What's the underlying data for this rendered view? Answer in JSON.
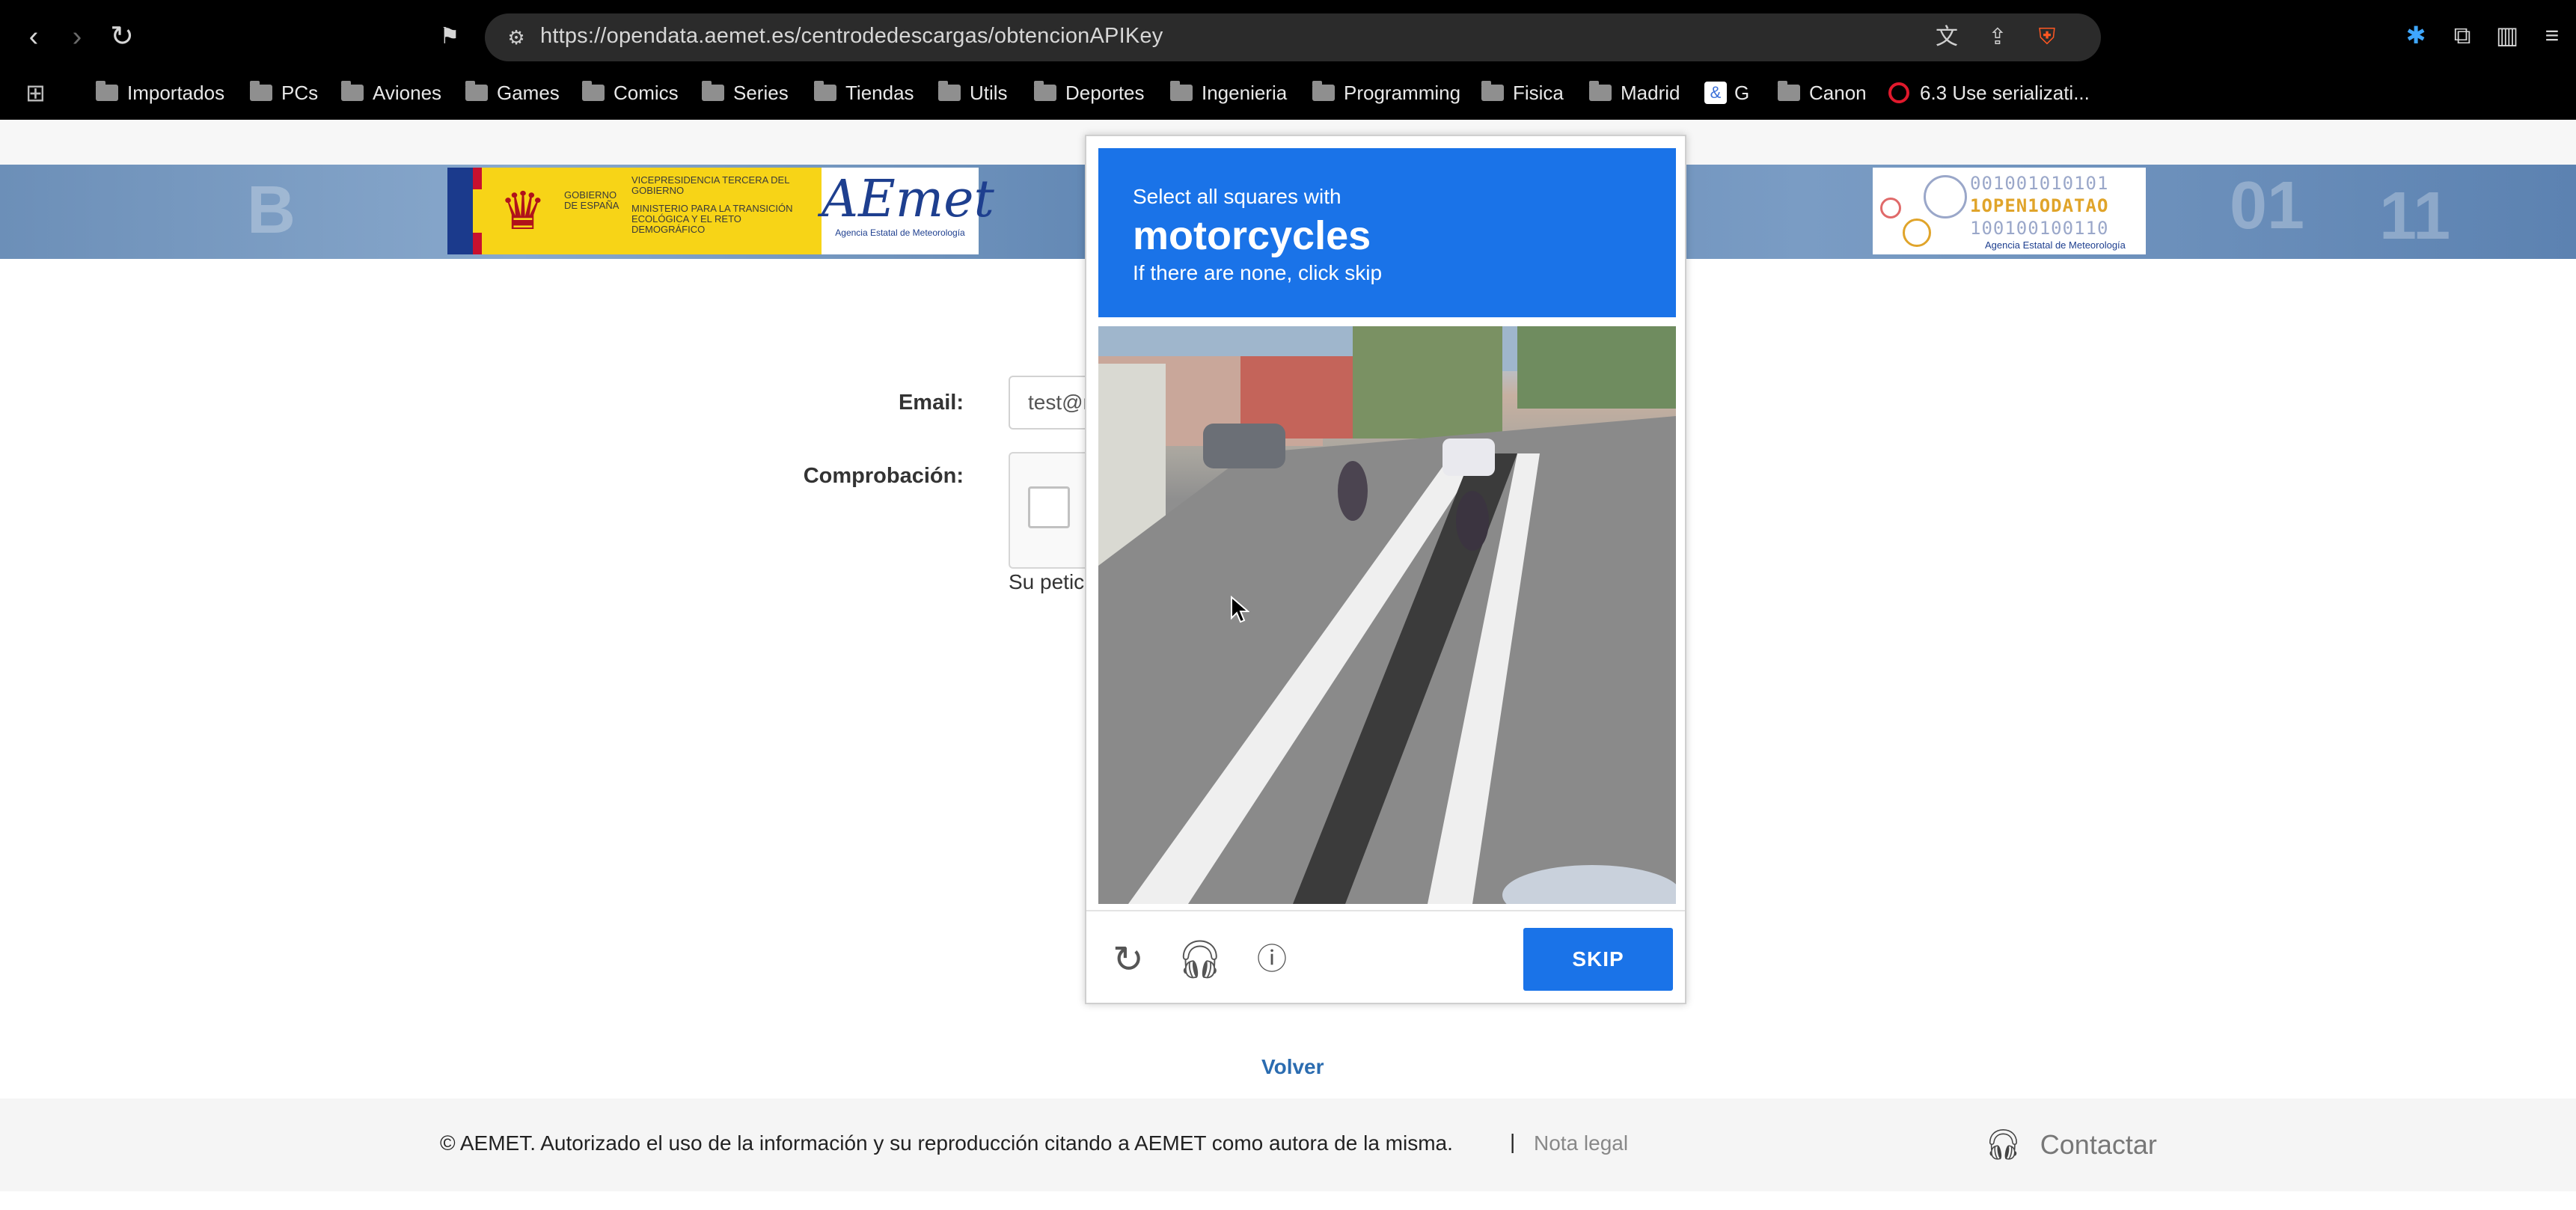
{
  "browser": {
    "url": "https://opendata.aemet.es/centrodedescargas/obtencionAPIKey",
    "nav": {
      "back_icon": "back-arrow-icon",
      "forward_icon": "forward-arrow-icon",
      "reload_icon": "reload-icon"
    },
    "bookmarks": [
      {
        "label": "Importados"
      },
      {
        "label": "PCs"
      },
      {
        "label": "Aviones"
      },
      {
        "label": "Games"
      },
      {
        "label": "Comics"
      },
      {
        "label": "Series"
      },
      {
        "label": "Tiendas"
      },
      {
        "label": "Utils"
      },
      {
        "label": "Deportes"
      },
      {
        "label": "Ingenieria"
      },
      {
        "label": "Programming"
      },
      {
        "label": "Fisica"
      },
      {
        "label": "Madrid"
      },
      {
        "label": "G"
      },
      {
        "label": "Canon"
      },
      {
        "label": "6.3 Use serializati..."
      }
    ],
    "accent_color": "#ff5722"
  },
  "header": {
    "gov_text_1": "GOBIERNO DE ESPAÑA",
    "gov_text_2": "VICEPRESIDENCIA TERCERA DEL GOBIERNO",
    "gov_text_3": "MINISTERIO PARA LA TRANSICIÓN ECOLÓGICA Y EL RETO DEMOGRÁFICO",
    "aemet_mark": "AEmet",
    "aemet_sub": "Agencia Estatal de Meteorología",
    "opendata_bits_1": "001001010101",
    "opendata_bits_2": "1OPEN1ODATAO",
    "opendata_bits_3": "100100100110",
    "opendata_sub": "Agencia Estatal de Meteorología"
  },
  "form": {
    "email_label": "Email:",
    "email_value": "test@r",
    "check_label": "Comprobación:",
    "request_text": "Su petic"
  },
  "captcha": {
    "pre": "Select all squares with",
    "object": "motorcycles",
    "post": "If there are none, click skip",
    "skip_label": "SKIP",
    "brand_color": "#1a73e8",
    "icons": [
      "reload-icon",
      "headphones-icon",
      "info-icon"
    ]
  },
  "page": {
    "back_link": "Volver",
    "copyright": "© AEMET. Autorizado el uso de la información y su reproducción citando a AEMET como autora de la misma.",
    "separator": "|",
    "legal_link": "Nota legal",
    "contact": "Contactar"
  }
}
